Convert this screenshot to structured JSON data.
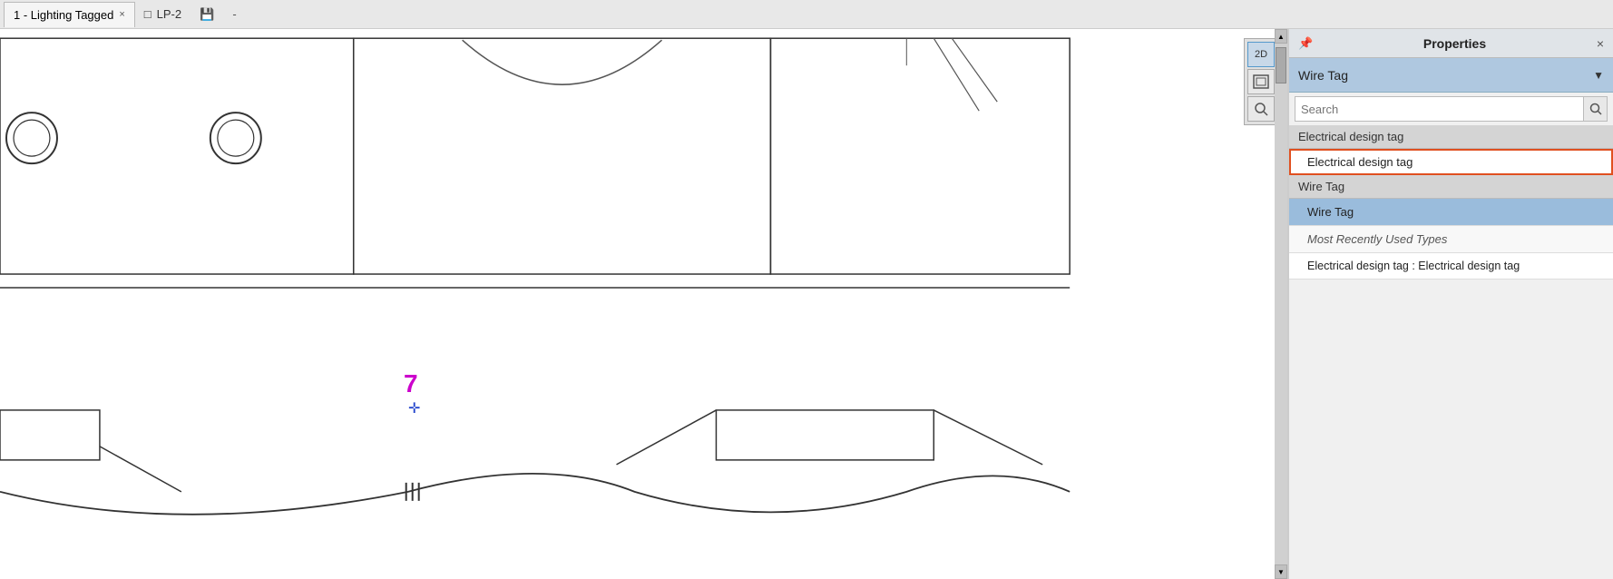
{
  "titleBar": {
    "tab1": {
      "label": "1 - Lighting Tagged",
      "closeLabel": "×"
    },
    "docIcon": "□",
    "doc2Label": "LP-2",
    "saveIcon": "💾",
    "dash": "-"
  },
  "properties": {
    "panelTitle": "Properties",
    "pinIcon": "📌",
    "closeIcon": "×",
    "wireTagLabel": "Wire Tag",
    "dropdownArrow": "▼",
    "search": {
      "placeholder": "Search",
      "iconLabel": "🔍"
    },
    "categories": [
      {
        "label": "Electrical design tag",
        "items": [
          {
            "label": "Electrical design tag",
            "state": "selected-orange"
          }
        ]
      },
      {
        "label": "Wire Tag",
        "items": [
          {
            "label": "Wire Tag",
            "state": "selected-blue"
          }
        ]
      }
    ],
    "mostRecentlyUsed": {
      "headerLabel": "Most Recently Used Types",
      "items": [
        {
          "label": "Electrical design tag : Electrical design tag",
          "state": "normal"
        }
      ]
    }
  },
  "canvas": {
    "numberLabel": "7",
    "cursorLabel": "✛"
  },
  "toolbar": {
    "btn2D": "2D",
    "btnView": "⊡",
    "btnZoom": "🔍"
  },
  "scrollbar": {
    "upArrow": "▲",
    "downArrow": "▼"
  }
}
